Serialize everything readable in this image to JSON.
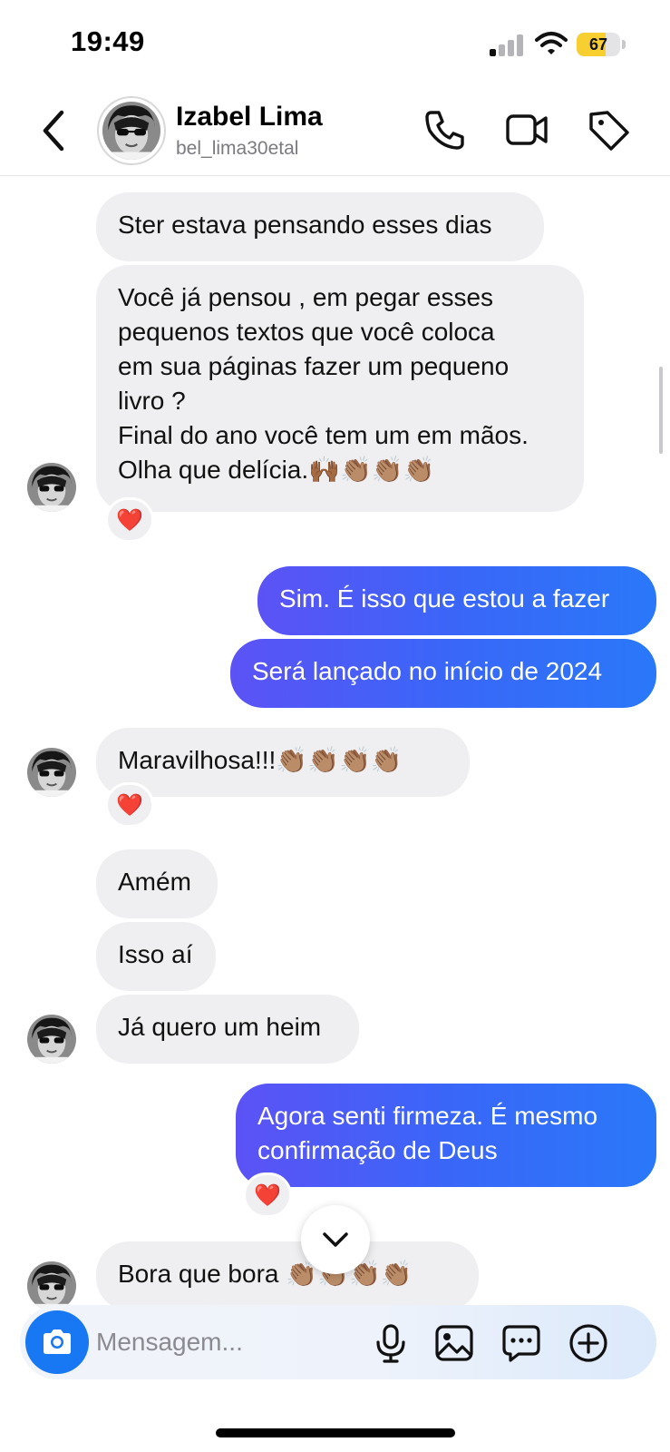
{
  "status_bar": {
    "time": "19:49",
    "battery_level": "67",
    "battery_color": "#f7cf31"
  },
  "header": {
    "contact_name": "Izabel Lima",
    "contact_username": "bel_lima30etal",
    "icons": [
      "back-icon",
      "phone-icon",
      "video-camera-icon",
      "tag-icon"
    ]
  },
  "conversation": {
    "received_bubble_color": "#efeff1",
    "sent_gradient": [
      "#5c52f5",
      "#3a66f8",
      "#2a78f9"
    ],
    "messages": [
      {
        "id": "m1",
        "from": "contact",
        "text": "Ster estava pensando esses dias"
      },
      {
        "id": "m2",
        "from": "contact",
        "text": "Você já pensou , em pegar esses\npequenos textos que você coloca\nem sua páginas fazer um pequeno\nlivro ?\nFinal do ano você tem um em mãos.\nOlha que delícia.🙌🏾👏🏽👏🏽👏🏽",
        "reaction": "❤️"
      },
      {
        "id": "m3",
        "from": "me",
        "text": "Sim. É isso que estou a fazer"
      },
      {
        "id": "m4",
        "from": "me",
        "text": "Será lançado no início de 2024"
      },
      {
        "id": "m5",
        "from": "contact",
        "text": "Maravilhosa!!!👏🏽👏🏽👏🏽👏🏽",
        "reaction": "❤️"
      },
      {
        "id": "m6",
        "from": "contact",
        "text": "Amém"
      },
      {
        "id": "m7",
        "from": "contact",
        "text": "Isso aí"
      },
      {
        "id": "m8",
        "from": "contact",
        "text": "Já quero um heim"
      },
      {
        "id": "m9",
        "from": "me",
        "text": "Agora senti firmeza. É mesmo\nconfirmação de Deus",
        "reaction": "❤️"
      },
      {
        "id": "m10",
        "from": "contact",
        "text": "Bora que bora 👏🏽👏🏽👏🏽👏🏽"
      }
    ]
  },
  "composer": {
    "placeholder": "Mensagem...",
    "icons": [
      "camera-icon",
      "microphone-icon",
      "image-icon",
      "sticker-chat-icon",
      "add-icon"
    ],
    "camera_color": "#1877f2"
  },
  "scroll_down_icon": "chevron-down-icon"
}
